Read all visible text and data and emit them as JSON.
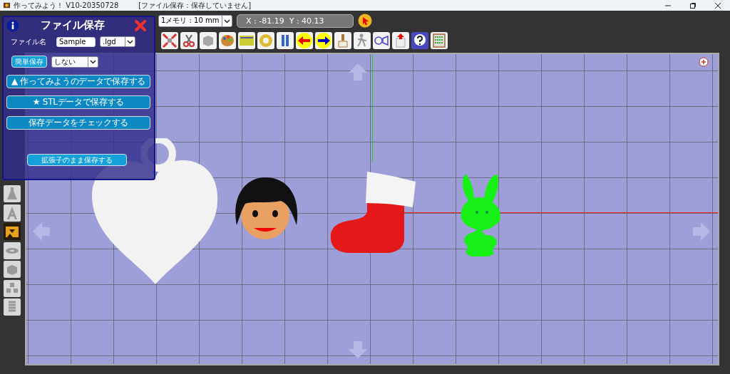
{
  "window": {
    "title": "作ってみよう！ V10-20350728",
    "save_status": "[ファイル保存：保存していません]"
  },
  "toolbar": {
    "scale_select": "1メモリ : 10 mm",
    "coordinates": "X : -81.19  Y : 40.13"
  },
  "save_dialog": {
    "title": "ファイル保存",
    "filename_label": "ファイル名",
    "filename": "Sample",
    "extension": ".lgd",
    "quick_save_button": "簡単保存",
    "quick_save_option": "しない",
    "buttons": [
      "▲ 作ってみようのデータで保存する",
      "★ STLデータで保存する",
      "保存データをチェックする"
    ],
    "keep_extension_button": "拡張子のまま保存する"
  }
}
